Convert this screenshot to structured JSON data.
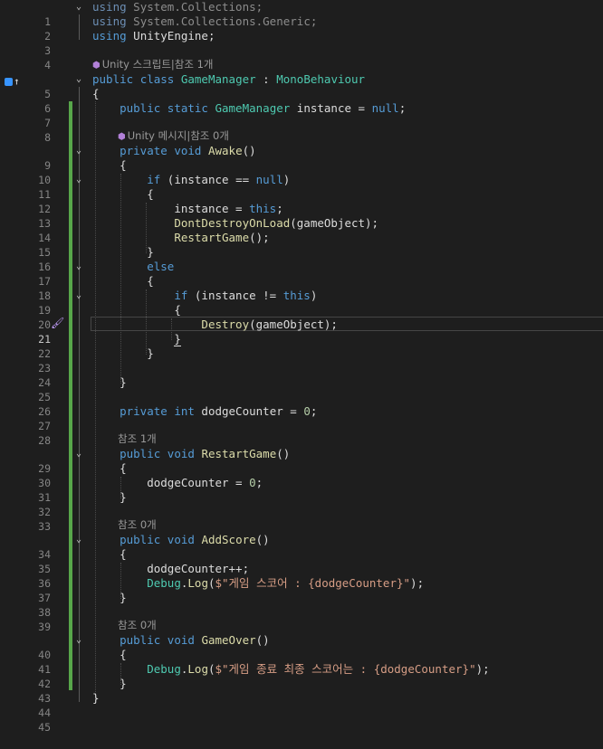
{
  "editor": {
    "line_numbers": [
      "1",
      "2",
      "3",
      "4",
      "5",
      "6",
      "7",
      "8",
      "9",
      "10",
      "11",
      "12",
      "13",
      "14",
      "15",
      "16",
      "17",
      "18",
      "19",
      "20",
      "21",
      "22",
      "23",
      "24",
      "25",
      "26",
      "27",
      "28",
      "29",
      "30",
      "31",
      "32",
      "33",
      "34",
      "35",
      "36",
      "37",
      "38",
      "39",
      "40",
      "41",
      "42",
      "43",
      "44",
      "45"
    ],
    "current_line": "21",
    "lens": {
      "class_refs": "Unity 스크립트|참조 1개",
      "awake_refs": "Unity 메시지|참조 0개",
      "restart_refs": "참조 1개",
      "addscore_refs": "참조 0개",
      "gameover_refs": "참조 0개"
    },
    "icons": {
      "gutter_top": "implementation-up-arrow-icon",
      "gutter_line21": "paintbrush-icon",
      "fold": "chevron-down-icon",
      "lens": "unity-cube-icon"
    },
    "colors": {
      "background": "#1e1e1e",
      "keyword": "#569cd6",
      "type": "#4ec9b0",
      "method": "#dcdcaa",
      "string": "#d69d85",
      "number": "#b5cea8",
      "change_bar": "#57a64a"
    },
    "t": {
      "using": "using",
      "ns_collections": "System.Collections;",
      "ns_generic": "System.Collections.Generic;",
      "ns_unity": "UnityEngine;",
      "public": "public",
      "private": "private",
      "class": "class",
      "static": "static",
      "void": "void",
      "int": "int",
      "if": "if",
      "else": "else",
      "null": "null",
      "this": "this",
      "GameManager": "GameManager",
      "colon": " : ",
      "MonoBehaviour": "MonoBehaviour",
      "brace_open": "{",
      "brace_close": "}",
      "instance_null_tail": " instance = ",
      "semicolon": ";",
      "Awake": "Awake",
      "parens": "()",
      "if_open": " (instance == ",
      "if_open_ne": " (instance != ",
      "close_paren": ")",
      "instance_assign": "instance = ",
      "DontDestroyOnLoad": "DontDestroyOnLoad",
      "gameObject_arg": "(gameObject);",
      "RestartGame": "RestartGame",
      "call_end": "();",
      "Destroy": "Destroy",
      "dodge_decl": " dodgeCounter = ",
      "zero": "0",
      "dodge_assign": "dodgeCounter = ",
      "AddScore": "AddScore",
      "dodge_inc": "dodgeCounter++;",
      "Debug": "Debug",
      "dot_log": ".",
      "Log": "Log",
      "log_open": "(",
      "str_score": "$\"게임 스코어 : {dodgeCounter}\"",
      "str_final": "$\"게임 종료 최종 스코어는 : {dodgeCounter}\"",
      "log_close": ");",
      "GameOver": "GameOver"
    }
  }
}
